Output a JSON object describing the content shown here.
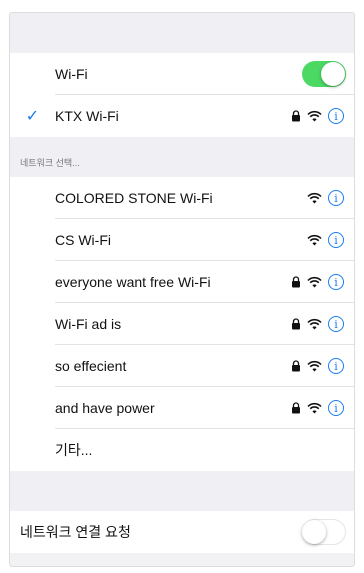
{
  "colors": {
    "accent": "#1a7bf5",
    "toggle_on": "#4bd964",
    "group_bg": "#efeff4"
  },
  "wifi": {
    "label": "Wi-Fi",
    "enabled": true
  },
  "connected": {
    "name": "KTX Wi-Fi",
    "secured": true,
    "icon": "checkmark-icon"
  },
  "choose_network": {
    "header": "네트워크 선택...",
    "networks": [
      {
        "name": "COLORED STONE Wi-Fi",
        "secured": false
      },
      {
        "name": "CS Wi-Fi",
        "secured": false
      },
      {
        "name": "everyone want free Wi-Fi",
        "secured": true
      },
      {
        "name": "Wi-Fi ad is",
        "secured": true
      },
      {
        "name": "so effecient",
        "secured": true
      },
      {
        "name": "and have power",
        "secured": true
      }
    ],
    "other_label": "기타..."
  },
  "ask_to_join": {
    "label": "네트워크 연결 요청",
    "enabled": false
  }
}
